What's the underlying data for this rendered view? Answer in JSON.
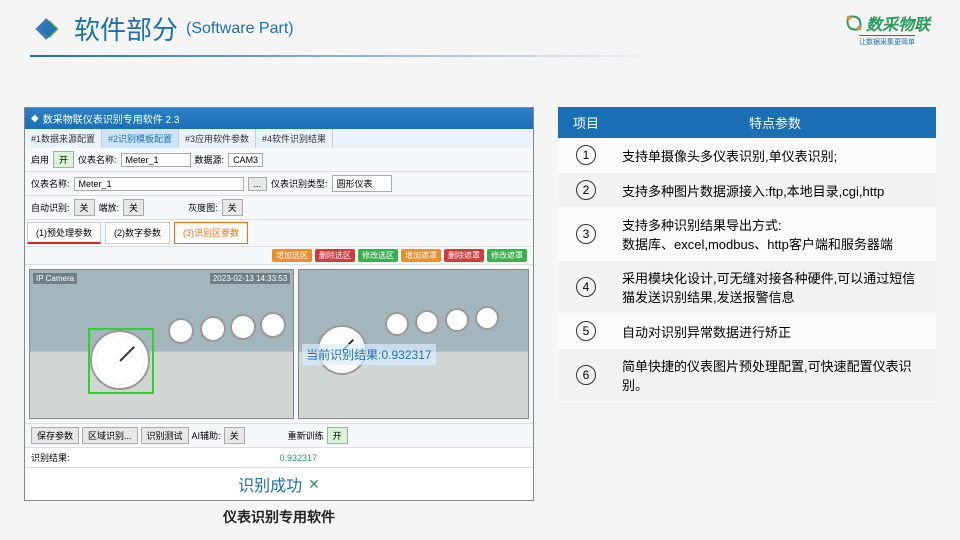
{
  "header": {
    "title_cn": "软件部分",
    "title_en": "(Software Part)",
    "brand_text": "数采物联",
    "brand_sub": "让数据采集更简单"
  },
  "software": {
    "window_title": "数采物联仪表识别专用软件 2.3",
    "tabs": [
      "#1数据来源配置",
      "#2识别模板配置",
      "#3应用软件参数",
      "#4软件识别结果"
    ],
    "active_tab": 1,
    "toolbar": {
      "enable_label": "启用",
      "enable_btn": "开",
      "meter_label": "仪表名称:",
      "meter_value": "Meter_1",
      "src_label": "数据源:",
      "src_value": "CAM3"
    },
    "toolbar2": {
      "meter_label": "仪表名称:",
      "meter_value": "Meter_1",
      "ellipsis": "...",
      "type_label": "仪表识别类型:",
      "type_value": "圆形仪表"
    },
    "toolbar3": {
      "auto_label": "自动识别:",
      "auto_btn": "关",
      "rotate_label": "端放:",
      "rotate_btn": "关",
      "gray_label": "灰度图:",
      "gray_btn": "关"
    },
    "subtabs": [
      "(1)预处理参数",
      "(2)数字参数",
      "(3)识别区参数"
    ],
    "smallbtns": [
      {
        "t": "增加选区",
        "c": "#f08c2a"
      },
      {
        "t": "删除选区",
        "c": "#d43a3a"
      },
      {
        "t": "修改选区",
        "c": "#36b24a"
      },
      {
        "t": "增加遮罩",
        "c": "#f08c2a"
      },
      {
        "t": "删除遮罩",
        "c": "#d43a3a"
      },
      {
        "t": "修改遮罩",
        "c": "#36b24a"
      }
    ],
    "cam": {
      "label": "IP Camera",
      "date": "2023-02-13 14:33:53",
      "overlay": "当前识别结果:0.932317"
    },
    "bottom": {
      "save": "保存参数",
      "area": "区域识别...",
      "test": "识别测试",
      "ai": "AI辅助:",
      "ai_btn": "关",
      "retrain": "重新训练",
      "retrain_btn": "开"
    },
    "result": {
      "label": "识别结果:",
      "val": "0.932317"
    },
    "success": "识别成功",
    "caption": "仪表识别专用软件"
  },
  "table": {
    "headers": [
      "项目",
      "特点参数"
    ],
    "rows": [
      {
        "n": "1",
        "t": "支持单摄像头多仪表识别,单仪表识别;"
      },
      {
        "n": "2",
        "t": "支持多种图片数据源接入:ftp,本地目录,cgi,http"
      },
      {
        "n": "3",
        "t": "支持多种识别结果导出方式:\n数据库、excel,modbus、http客户端和服务器端"
      },
      {
        "n": "4",
        "t": "采用模块化设计,可无缝对接各种硬件,可以通过短信猫发送识别结果,发送报警信息"
      },
      {
        "n": "5",
        "t": "自动对识别异常数据进行矫正"
      },
      {
        "n": "6",
        "t": "简单快捷的仪表图片预处理配置,可快速配置仪表识别。"
      }
    ]
  }
}
